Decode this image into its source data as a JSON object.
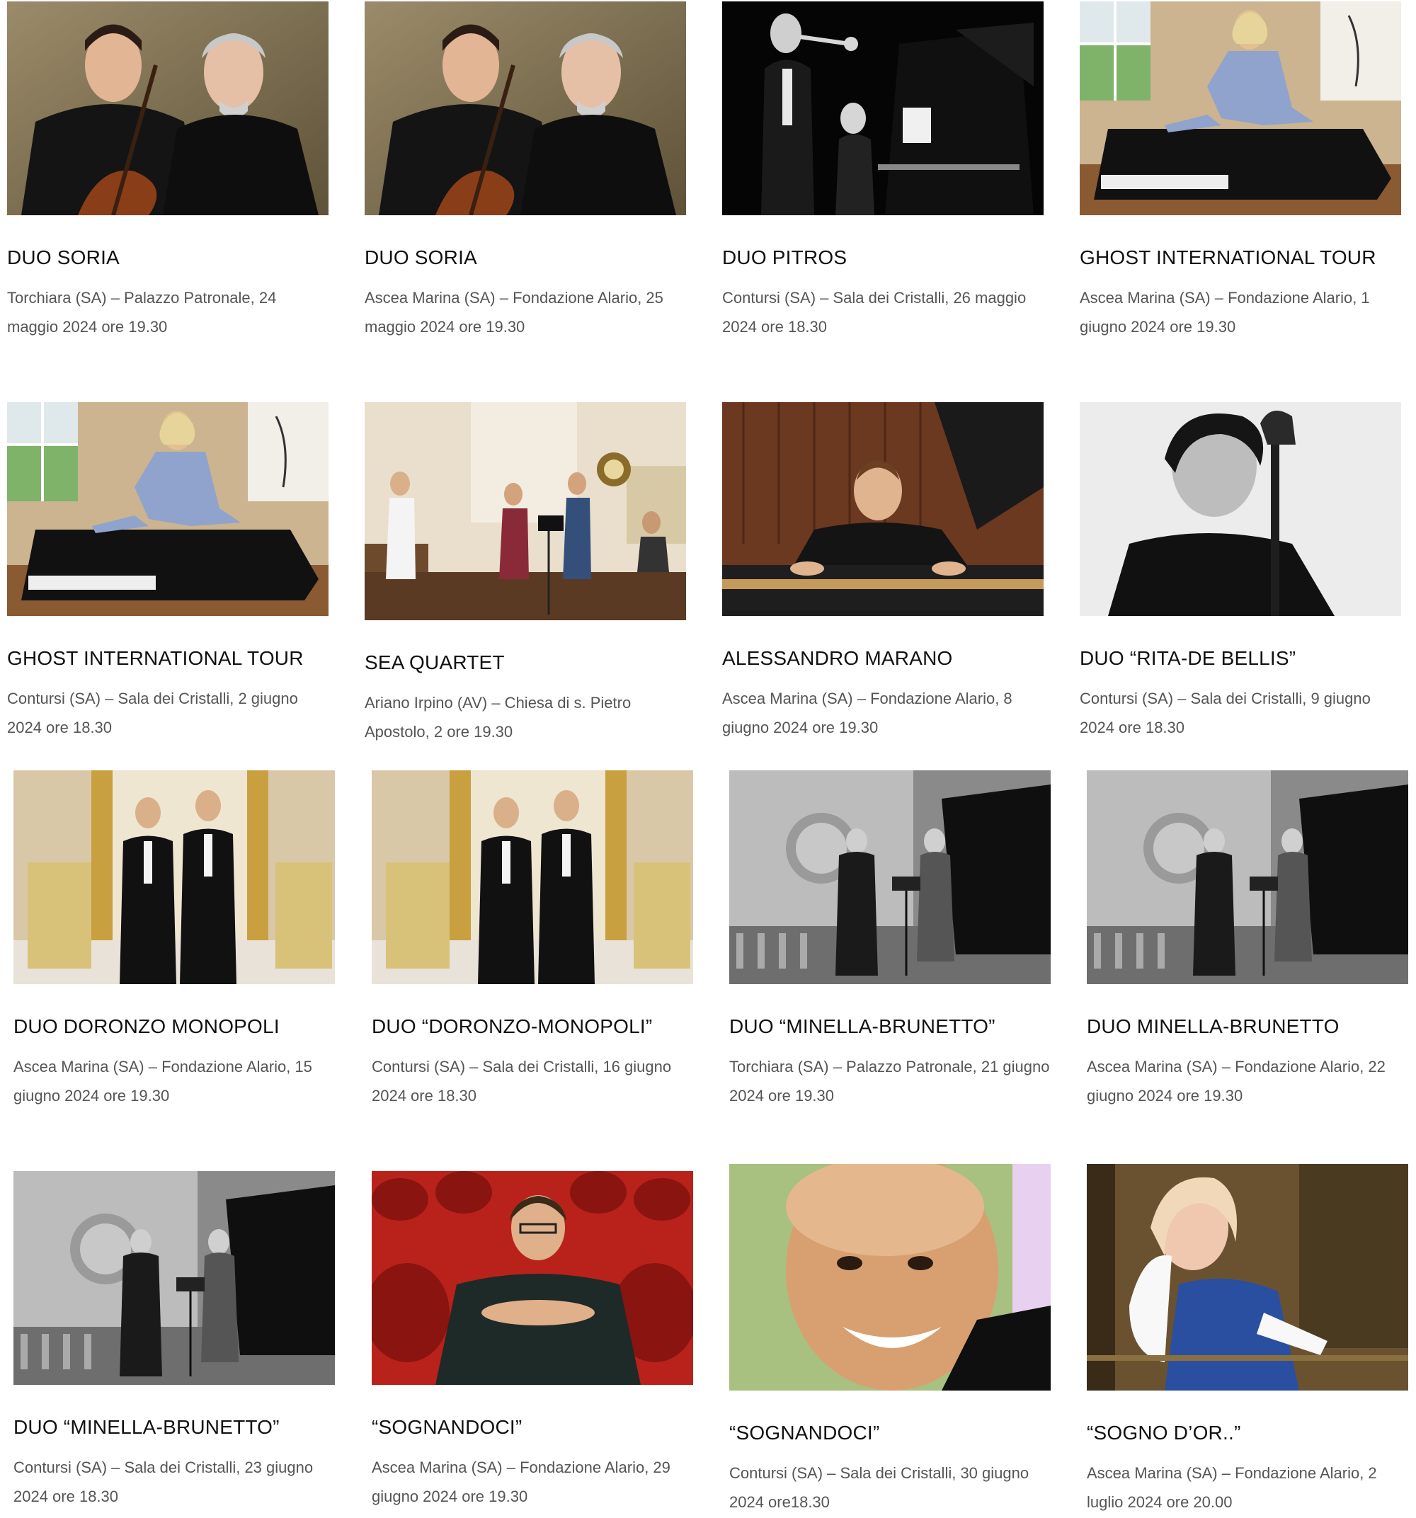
{
  "events": [
    {
      "title": "DUO SORIA",
      "details": "Torchiara (SA) – Palazzo Patronale, 24 maggio 2024 ore 19.30",
      "photo": "duo-soria-portrait-photo"
    },
    {
      "title": "DUO SORIA",
      "details": "Ascea Marina (SA) – Fondazione Alario, 25 maggio 2024 ore 19.30",
      "photo": "duo-soria-portrait-photo"
    },
    {
      "title": "DUO PITROS",
      "details": "Contursi (SA) – Sala dei Cristalli, 26 maggio 2024 ore 18.30",
      "photo": "trumpet-piano-photo"
    },
    {
      "title": "GHOST INTERNATIONAL TOUR",
      "details": "Ascea Marina (SA) – Fondazione Alario, 1 giugno 2024 ore 19.30",
      "photo": "pianist-on-piano-photo"
    },
    {
      "title": "GHOST INTERNATIONAL TOUR",
      "details": "Contursi (SA) – Sala dei Cristalli, 2 giugno 2024 ore 18.30",
      "photo": "pianist-on-piano-photo"
    },
    {
      "title": "SEA QUARTET",
      "details": "Ariano Irpino (AV) – Chiesa di s. Pietro Apostolo, 2  ore 19.30",
      "photo": "string-quartet-church-photo"
    },
    {
      "title": "ALESSANDRO MARANO",
      "details": "Ascea Marina (SA) – Fondazione Alario, 8 giugno 2024 ore 19.30",
      "photo": "pianist-portrait-photo"
    },
    {
      "title": "DUO “RITA-DE BELLIS”",
      "details": "Contursi (SA) – Sala dei Cristalli, 9 giugno 2024 ore 18.30",
      "photo": "cellist-bw-portrait-photo"
    },
    {
      "title": "DUO DORONZO MONOPOLI",
      "details": "Ascea Marina (SA) – Fondazione Alario, 15 giugno 2024 ore 19.30",
      "photo": "duo-tuxedo-photo"
    },
    {
      "title": "DUO “DORONZO-MONOPOLI”",
      "details": "Contursi (SA) – Sala dei Cristalli, 16 giugno 2024 ore 18.30",
      "photo": "duo-tuxedo-photo"
    },
    {
      "title": "DUO “MINELLA-BRUNETTO”",
      "details": "Torchiara (SA) – Palazzo Patronale, 21 giugno 2024 ore 19.30",
      "photo": "violin-piano-bw-photo"
    },
    {
      "title": "DUO MINELLA-BRUNETTO",
      "details": "Ascea Marina (SA) – Fondazione Alario, 22 giugno 2024 ore 19.30",
      "photo": "violin-piano-bw-photo"
    },
    {
      "title": "DUO “MINELLA-BRUNETTO”",
      "details": "Contursi (SA) – Sala dei Cristalli, 23 giugno 2024 ore 18.30",
      "photo": "violin-piano-bw-photo"
    },
    {
      "title": "“SOGNANDOCI”",
      "details": "Ascea Marina (SA) – Fondazione Alario, 29 giugno 2024 ore 19.30",
      "photo": "man-red-theater-seats-photo"
    },
    {
      "title": "“SOGNANDOCI”",
      "details": "Contursi (SA) – Sala dei Cristalli, 30 giugno 2024 ore18.30",
      "photo": "smiling-man-closeup-photo"
    },
    {
      "title": "“SOGNO D’OR..”",
      "details": "Ascea Marina (SA) – Fondazione Alario, 2 luglio 2024 ore 20.00",
      "photo": "singer-blue-dress-photo"
    }
  ]
}
